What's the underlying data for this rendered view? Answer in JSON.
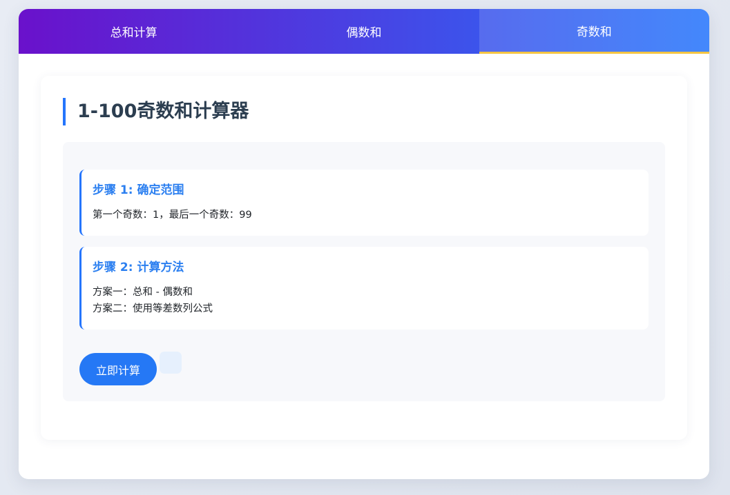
{
  "tabs": [
    {
      "label": "总和计算",
      "active": false
    },
    {
      "label": "偶数和",
      "active": false
    },
    {
      "label": "奇数和",
      "active": true
    }
  ],
  "panel": {
    "title": "1-100奇数和计算器"
  },
  "steps": [
    {
      "title": "步骤 1: 确定范围",
      "lines": [
        "第一个奇数：1，最后一个奇数：99"
      ]
    },
    {
      "title": "步骤 2: 计算方法",
      "lines": [
        "方案一：总和 - 偶数和",
        "方案二：使用等差数列公式"
      ]
    }
  ],
  "actions": {
    "calculate_label": "立即计算"
  },
  "colors": {
    "tab_gradient_start": "#6a11cb",
    "tab_gradient_end": "#2575fc",
    "active_tab_indicator": "#f5c542",
    "accent_blue": "#2575fc",
    "title_text": "#2c3e50"
  }
}
